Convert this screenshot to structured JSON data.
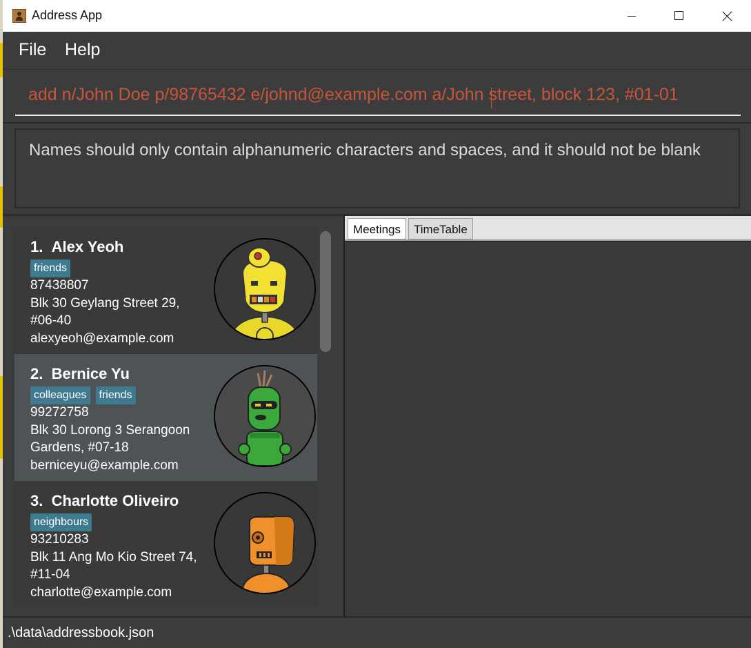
{
  "window": {
    "title": "Address App"
  },
  "menu": {
    "file": "File",
    "help": "Help"
  },
  "command_box": {
    "value": "add n/John Doe p/98765432 e/johnd@example.com a/John street, block 123, #01-01"
  },
  "result_display": {
    "text": "Names should only contain alphanumeric characters and spaces, and it should not be blank"
  },
  "persons": [
    {
      "index": "1.",
      "name": "Alex Yeoh",
      "tags": [
        "friends"
      ],
      "phone": "87438807",
      "address_line1": "Blk 30 Geylang Street 29,",
      "address_line2": "#06-40",
      "email": "alexyeoh@example.com",
      "avatar": "yellow-robot-icon",
      "selected": false
    },
    {
      "index": "2.",
      "name": "Bernice Yu",
      "tags": [
        "colleagues",
        "friends"
      ],
      "phone": "99272758",
      "address_line1": "Blk 30 Lorong 3 Serangoon",
      "address_line2": "Gardens, #07-18",
      "email": "berniceyu@example.com",
      "avatar": "green-robot-icon",
      "selected": true
    },
    {
      "index": "3.",
      "name": "Charlotte Oliveiro",
      "tags": [
        "neighbours"
      ],
      "phone": "93210283",
      "address_line1": "Blk 11 Ang Mo Kio Street 74,",
      "address_line2": "#11-04",
      "email": "charlotte@example.com",
      "avatar": "orange-robot-icon",
      "selected": false
    }
  ],
  "tabs": [
    {
      "label": "Meetings",
      "selected": true
    },
    {
      "label": "TimeTable",
      "selected": false
    }
  ],
  "status_bar": {
    "path": ".\\data\\addressbook.json"
  },
  "colors": {
    "tag": "#3e7b91",
    "selected_card": "#4e5456",
    "card": "#3a3a3a",
    "command_text": "#c8553a"
  }
}
